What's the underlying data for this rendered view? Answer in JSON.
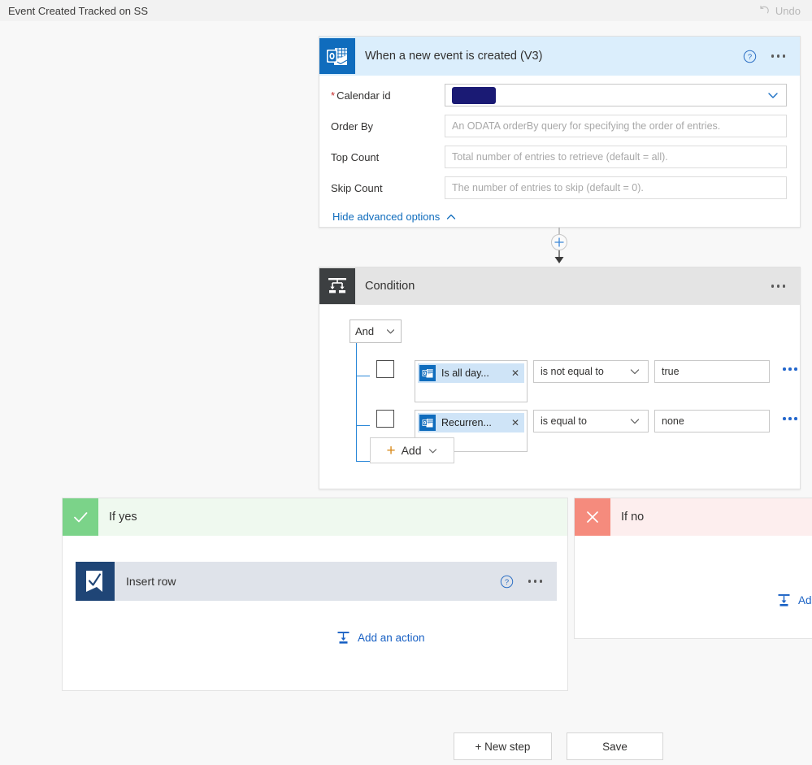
{
  "topbar": {
    "flow_title": "Event Created Tracked on SS",
    "undo_label": "Undo",
    "undo_icon": "undo-arrow-icon"
  },
  "trigger": {
    "icon": "outlook-calendar-icon",
    "title": "When a new event is created (V3)",
    "help_icon": "help-circle-icon",
    "more_icon": "ellipsis-icon",
    "fields": [
      {
        "label": "Calendar id",
        "required": true,
        "value": "",
        "redacted": true,
        "placeholder": "",
        "has_dropdown": true
      },
      {
        "label": "Order By",
        "required": false,
        "value": "",
        "redacted": false,
        "placeholder": "An ODATA orderBy query for specifying the order of entries.",
        "has_dropdown": false
      },
      {
        "label": "Top Count",
        "required": false,
        "value": "",
        "redacted": false,
        "placeholder": "Total number of entries to retrieve (default = all).",
        "has_dropdown": false
      },
      {
        "label": "Skip Count",
        "required": false,
        "value": "",
        "redacted": false,
        "placeholder": "The number of entries to skip (default = 0).",
        "has_dropdown": false
      }
    ],
    "advanced_link": "Hide advanced options",
    "advanced_chevron_icon": "chevron-up-icon"
  },
  "connector": {
    "insert_icon": "plus-circle-icon",
    "arrow_icon": "arrow-down-icon"
  },
  "condition": {
    "icon": "condition-branch-icon",
    "title": "Condition",
    "more_icon": "ellipsis-icon",
    "logic_operator": "And",
    "logic_chevron_icon": "chevron-down-icon",
    "rows": [
      {
        "checkbox_checked": false,
        "token_icon": "outlook-calendar-icon",
        "token_label": "Is all day...",
        "token_remove_icon": "close-x-icon",
        "operator": "is not equal to",
        "operator_chevron_icon": "chevron-down-icon",
        "value": "true",
        "more_icon": "ellipsis-icon"
      },
      {
        "checkbox_checked": false,
        "token_icon": "outlook-calendar-icon",
        "token_label": "Recurren...",
        "token_remove_icon": "close-x-icon",
        "operator": "is equal to",
        "operator_chevron_icon": "chevron-down-icon",
        "value": "none",
        "more_icon": "ellipsis-icon"
      }
    ],
    "add_label": "Add",
    "add_plus_icon": "plus-icon",
    "add_chevron_icon": "chevron-down-icon"
  },
  "branch_yes": {
    "label": "If yes",
    "icon": "checkmark-icon",
    "action": {
      "icon": "smartsheet-icon",
      "title": "Insert row",
      "help_icon": "help-circle-icon",
      "more_icon": "ellipsis-icon"
    },
    "add_action_label": "Add an action",
    "add_action_icon": "add-action-icon"
  },
  "branch_no": {
    "label": "If no",
    "icon": "close-x-icon",
    "add_action_label": "Add",
    "add_action_icon": "add-action-icon"
  },
  "footer": {
    "new_step_label": "+ New step",
    "save_label": "Save"
  },
  "colors": {
    "trigger_header": "#dbeefc",
    "condition_header": "#e4e4e4",
    "yes_accent": "#7bd389",
    "no_accent": "#f58b7d",
    "link_blue": "#0f6cbd",
    "outlook_blue": "#0f6cbd",
    "smartsheet_navy": "#1f4576"
  }
}
